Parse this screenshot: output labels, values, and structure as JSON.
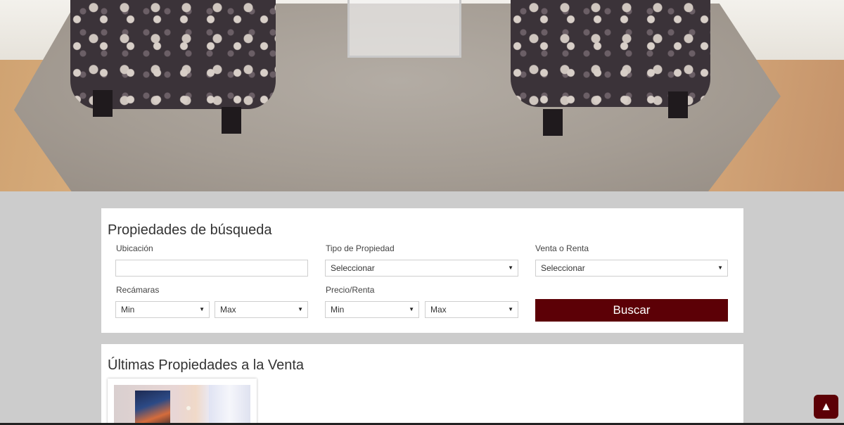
{
  "search": {
    "title": "Propiedades de búsqueda",
    "location_label": "Ubicación",
    "location_value": "",
    "property_type_label": "Tipo de Propiedad",
    "property_type_value": "Seleccionar",
    "sale_or_rent_label": "Venta o Renta",
    "sale_or_rent_value": "Seleccionar",
    "bedrooms_label": "Recámaras",
    "bedrooms_min": "Min",
    "bedrooms_max": "Max",
    "price_label": "Precio/Renta",
    "price_min": "Min",
    "price_max": "Max",
    "submit_label": "Buscar",
    "dropdown_arrow": "▼"
  },
  "latest": {
    "title": "Últimas Propiedades a la Venta"
  },
  "back_to_top": {
    "icon": "▲"
  },
  "colors": {
    "accent": "#5c0006",
    "page_background": "#cccccc"
  }
}
